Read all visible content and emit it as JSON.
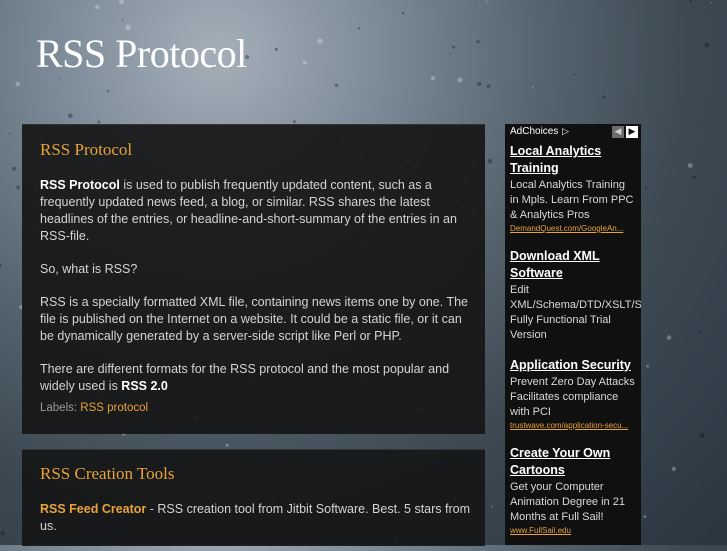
{
  "colors": {
    "accent": "#e8a33a",
    "post_background": "#161616",
    "ad_background": "#101010",
    "text": "#d4d4d4",
    "title": "#ffffff"
  },
  "blog": {
    "title": "RSS Protocol"
  },
  "posts": [
    {
      "title": "RSS Protocol",
      "p1_bold": "RSS Protocol",
      "p1_text": " is used to publish frequently updated content, such as a frequently updated news feed, a blog, or similar. RSS shares the latest headlines of the entries, or headline-and-short-summary of the entries in an RSS-file.",
      "p2_text": "So, what is RSS?",
      "p3_text": "RSS is a specially formatted XML file, containing news items one by one. The file is published on the Internet on a website. It could be a static file, or it can be dynamically generated by a server-side script like Perl or PHP.",
      "p4_text": "There are different formats for the RSS protocol and the most popular and widely used is ",
      "p4_bold": "RSS 2.0",
      "labels_prefix": "Labels:",
      "label": "RSS protocol"
    },
    {
      "title": "RSS Creation Tools",
      "link": "RSS Feed Creator",
      "text": " - RSS creation tool from Jitbit Software. Best. 5 stars from us."
    }
  ],
  "ad": {
    "adchoices": "AdChoices",
    "adchoices_icon": "▷",
    "prev_icon": "◀",
    "next_icon": "▶",
    "items": [
      {
        "headline": "Local Analytics Training",
        "desc": "Local Analytics Training in Mpls. Learn From PPC & Analytics Pros",
        "url": "DemandQuest.com/GoogleAn..."
      },
      {
        "headline": "Download XML Software",
        "desc": "Edit XML/Schema/DTD/XSLT/S Fully Functional Trial Version",
        "url": ""
      },
      {
        "headline": "Application Security",
        "desc": "Prevent Zero Day Attacks Facilitates compliance with PCI",
        "url": "trustwave.com/application-secu..."
      },
      {
        "headline": "Create Your Own Cartoons",
        "desc": "Get your Computer Animation Degree in 21 Months at Full Sail!",
        "url": "www.FullSail.edu"
      }
    ]
  }
}
